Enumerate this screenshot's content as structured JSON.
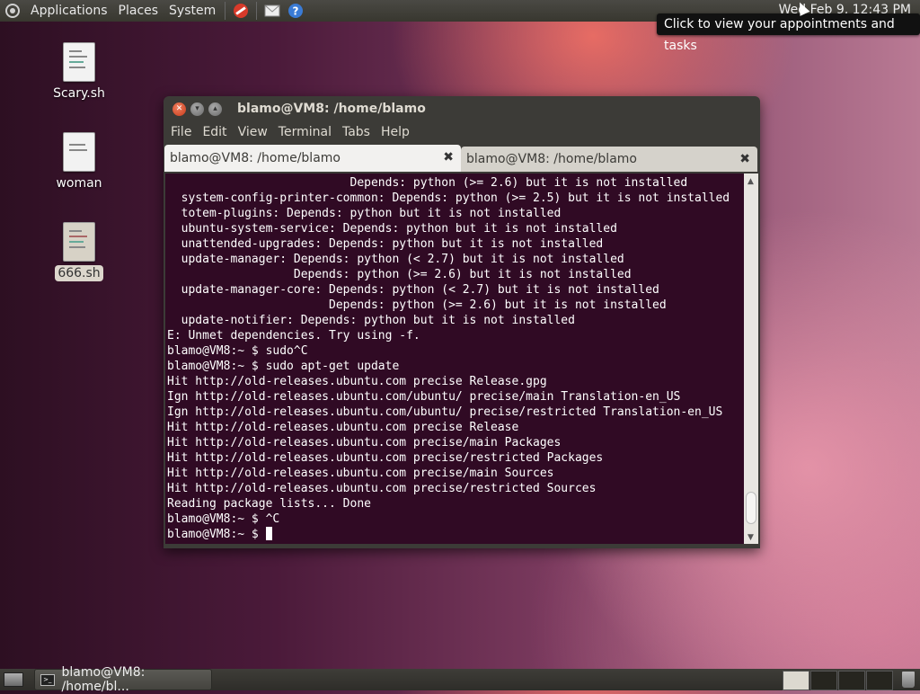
{
  "top_panel": {
    "menus": [
      "Applications",
      "Places",
      "System"
    ],
    "clock": "Wed Feb  9, 12:43 PM",
    "tooltip": "Click to view your appointments and tasks"
  },
  "desktop": {
    "icons": [
      {
        "label": "Scary.sh"
      },
      {
        "label": "woman"
      },
      {
        "label": "666.sh"
      }
    ]
  },
  "terminal": {
    "title": "blamo@VM8: /home/blamo",
    "menu": [
      "File",
      "Edit",
      "View",
      "Terminal",
      "Tabs",
      "Help"
    ],
    "tabs": [
      {
        "label": "blamo@VM8: /home/blamo"
      },
      {
        "label": "blamo@VM8: /home/blamo"
      }
    ],
    "lines": [
      "                          Depends: python (>= 2.6) but it is not installed",
      "  system-config-printer-common: Depends: python (>= 2.5) but it is not installed",
      "  totem-plugins: Depends: python but it is not installed",
      "  ubuntu-system-service: Depends: python but it is not installed",
      "  unattended-upgrades: Depends: python but it is not installed",
      "  update-manager: Depends: python (< 2.7) but it is not installed",
      "                  Depends: python (>= 2.6) but it is not installed",
      "  update-manager-core: Depends: python (< 2.7) but it is not installed",
      "                       Depends: python (>= 2.6) but it is not installed",
      "  update-notifier: Depends: python but it is not installed",
      "E: Unmet dependencies. Try using -f.",
      "blamo@VM8:~ $ sudo^C",
      "blamo@VM8:~ $ sudo apt-get update",
      "Hit http://old-releases.ubuntu.com precise Release.gpg",
      "Ign http://old-releases.ubuntu.com/ubuntu/ precise/main Translation-en_US",
      "Ign http://old-releases.ubuntu.com/ubuntu/ precise/restricted Translation-en_US",
      "Hit http://old-releases.ubuntu.com precise Release",
      "Hit http://old-releases.ubuntu.com precise/main Packages",
      "Hit http://old-releases.ubuntu.com precise/restricted Packages",
      "Hit http://old-releases.ubuntu.com precise/main Sources",
      "Hit http://old-releases.ubuntu.com precise/restricted Sources",
      "Reading package lists... Done",
      "blamo@VM8:~ $ ^C"
    ],
    "prompt": "blamo@VM8:~ $ "
  },
  "taskbar": {
    "window_button": "blamo@VM8: /home/bl..."
  }
}
